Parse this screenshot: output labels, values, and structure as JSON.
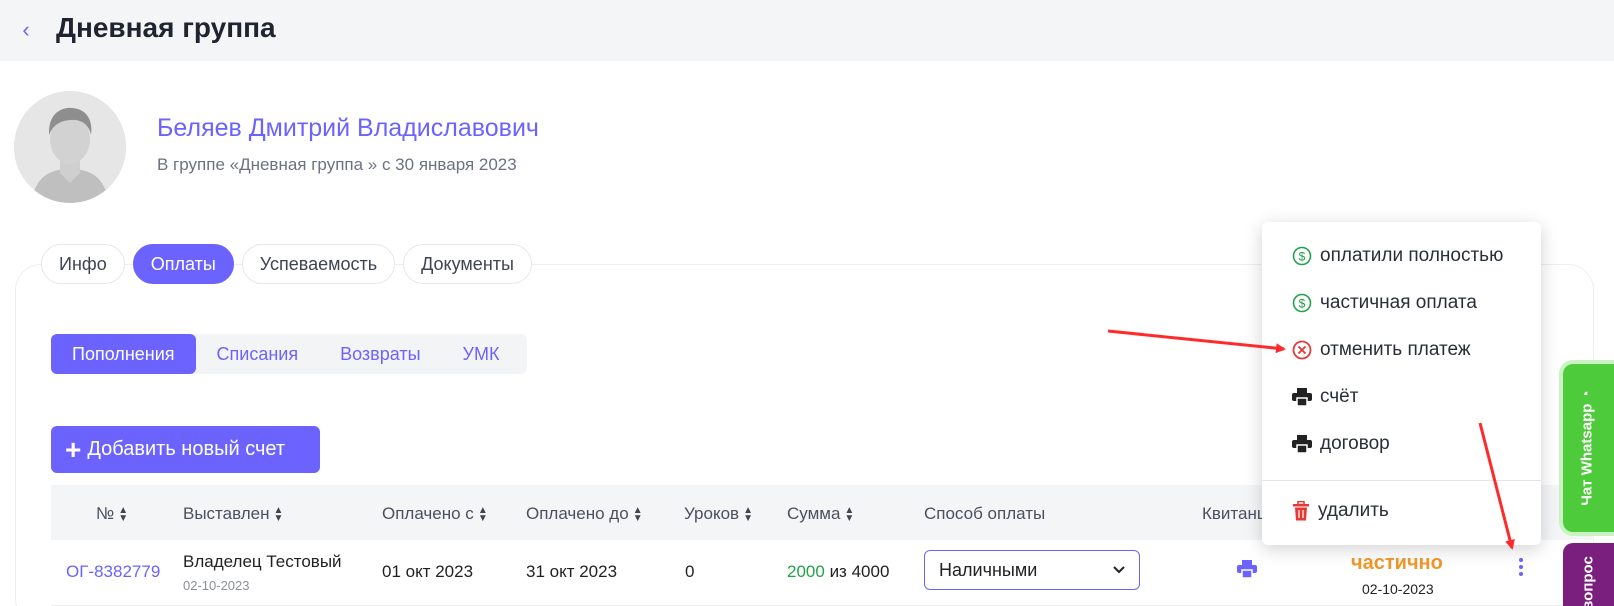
{
  "header": {
    "back_icon": "chevron-left-icon",
    "title": "Дневная группа"
  },
  "student": {
    "name": "Беляев Дмитрий Владиславович",
    "subtitle": "В группе «Дневная группа » с 30 января 2023"
  },
  "tabs": [
    {
      "label": "Инфо",
      "active": false
    },
    {
      "label": "Оплаты",
      "active": true
    },
    {
      "label": "Успеваемость",
      "active": false
    },
    {
      "label": "Документы",
      "active": false
    }
  ],
  "subtabs": [
    {
      "label": "Пополнения",
      "active": true
    },
    {
      "label": "Списания",
      "active": false
    },
    {
      "label": "Возвраты",
      "active": false
    },
    {
      "label": "УМК",
      "active": false
    }
  ],
  "add_button": {
    "label": "Добавить новый счет",
    "icon": "plus-icon"
  },
  "table": {
    "headers": [
      "№",
      "Выставлен",
      "Оплачено с",
      "Оплачено до",
      "Уроков",
      "Сумма",
      "Способ оплаты",
      "Квитанц"
    ],
    "rows": [
      {
        "number": "ОГ-8382779",
        "issued_by": "Владелец Тестовый",
        "issued_date": "02-10-2023",
        "paid_from": "01 окт 2023",
        "paid_to": "31 окт 2023",
        "lessons": "0",
        "amount_paid": "2000",
        "amount_sep": "из",
        "amount_total": "4000",
        "payment_method": "Наличными",
        "status": "частично",
        "status_date": "02-10-2023"
      }
    ]
  },
  "context_menu": {
    "items": [
      {
        "label": "оплатили полностью",
        "icon": "dollar-circle-icon"
      },
      {
        "label": "частичная оплата",
        "icon": "dollar-circle-icon"
      },
      {
        "label": "отменить платеж",
        "icon": "x-circle-icon"
      },
      {
        "label": "счёт",
        "icon": "printer-icon"
      },
      {
        "label": "договор",
        "icon": "printer-icon"
      },
      {
        "label": "удалить",
        "icon": "trash-icon"
      }
    ]
  },
  "side_widgets": {
    "whatsapp": "Чат Whatsapp",
    "question": "вопрос"
  },
  "colors": {
    "accent": "#6c63ff",
    "paid": "#22a34a",
    "partial": "#f2962a",
    "danger": "#e53935",
    "whatsapp": "#4ecb3a",
    "question": "#7b1f7e"
  }
}
